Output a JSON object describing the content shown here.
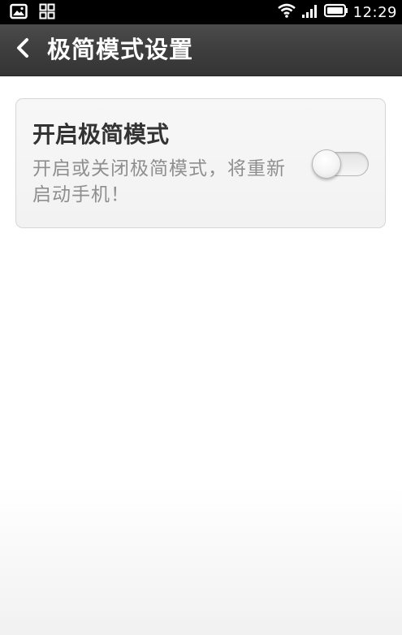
{
  "status_bar": {
    "left_icons": [
      "gallery-icon",
      "apps-grid-icon"
    ],
    "right_icons": [
      "wifi-icon",
      "signal-icon",
      "battery-icon"
    ],
    "time": "12:29"
  },
  "action_bar": {
    "back_icon": "chevron-left-icon",
    "title": "极简模式设置"
  },
  "setting": {
    "title": "开启极简模式",
    "description": "开启或关闭极简模式，将重新启动手机！",
    "toggle": {
      "state": "off"
    }
  },
  "colors": {
    "status_bar_bg": "#000000",
    "action_bar_bg": "#3f3f3f",
    "card_bg": "#f4f4f4",
    "title_text": "#333333",
    "desc_text": "#8f8f8f"
  }
}
